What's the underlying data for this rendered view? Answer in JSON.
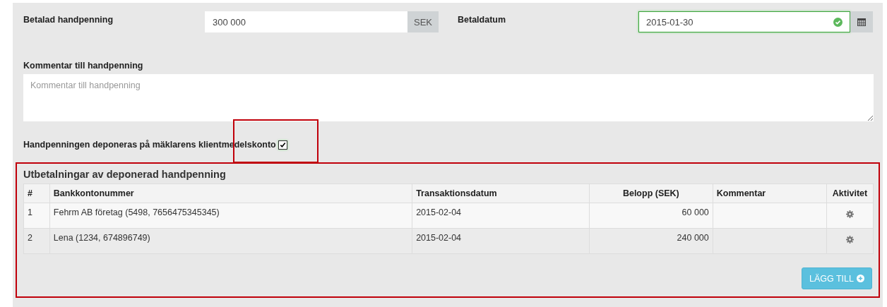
{
  "paid_deposit": {
    "label": "Betalad handpenning",
    "value": "300 000",
    "unit": "SEK"
  },
  "payment_date": {
    "label": "Betaldatum",
    "value": "2015-01-30",
    "valid": true
  },
  "comment": {
    "label": "Kommentar till handpenning",
    "placeholder": "Kommentar till handpenning"
  },
  "deposit_checkbox": {
    "label": "Handpenningen deponeras på mäklarens klientmedelskonto",
    "checked": true
  },
  "payouts": {
    "title": "Utbetalningar av deponerad handpenning",
    "columns": [
      "#",
      "Bankkontonummer",
      "Transaktionsdatum",
      "Belopp (SEK)",
      "Kommentar",
      "Aktivitet"
    ],
    "rows": [
      {
        "index": "1",
        "account": "Fehrm AB företag (5498, 7656475345345)",
        "date": "2015-02-04",
        "amount": "60 000"
      },
      {
        "index": "2",
        "account": "Lena (1234, 674896749)",
        "date": "2015-02-04",
        "amount": "240 000"
      }
    ],
    "add_button": "LÄGG TILL"
  }
}
